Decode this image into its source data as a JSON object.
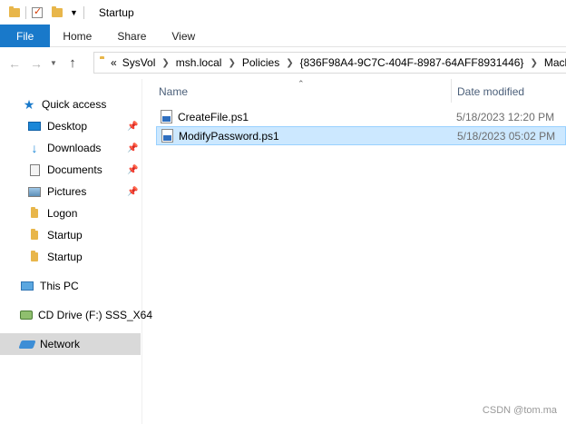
{
  "window": {
    "title": "Startup",
    "quick_access_toolbar": [
      "folder-icon",
      "properties-icon",
      "new-folder-icon",
      "customize-dropdown-icon"
    ]
  },
  "ribbon": {
    "tabs": [
      "File",
      "Home",
      "Share",
      "View"
    ]
  },
  "address": {
    "prefix": "«",
    "crumbs": [
      "SysVol",
      "msh.local",
      "Policies",
      "{836F98A4-9C7C-404F-8987-64AFF8931446}",
      "Machin"
    ]
  },
  "navpane": {
    "quick_access": "Quick access",
    "pinned": [
      {
        "label": "Desktop",
        "icon": "desktop-icon"
      },
      {
        "label": "Downloads",
        "icon": "downloads-icon"
      },
      {
        "label": "Documents",
        "icon": "documents-icon"
      },
      {
        "label": "Pictures",
        "icon": "pictures-icon"
      }
    ],
    "folders": [
      "Logon",
      "Startup",
      "Startup"
    ],
    "this_pc": "This PC",
    "cd_drive": "CD Drive (F:) SSS_X64",
    "network": "Network"
  },
  "content": {
    "columns": {
      "name": "Name",
      "date": "Date modified"
    },
    "files": [
      {
        "name": "CreateFile.ps1",
        "date": "5/18/2023 12:20 PM",
        "selected": false
      },
      {
        "name": "ModifyPassword.ps1",
        "date": "5/18/2023 05:02 PM",
        "selected": true
      }
    ]
  },
  "watermark": "CSDN @tom.ma",
  "colors": {
    "accent": "#1979ca",
    "selection": "#cce8ff",
    "folder": "#e8b64a"
  }
}
